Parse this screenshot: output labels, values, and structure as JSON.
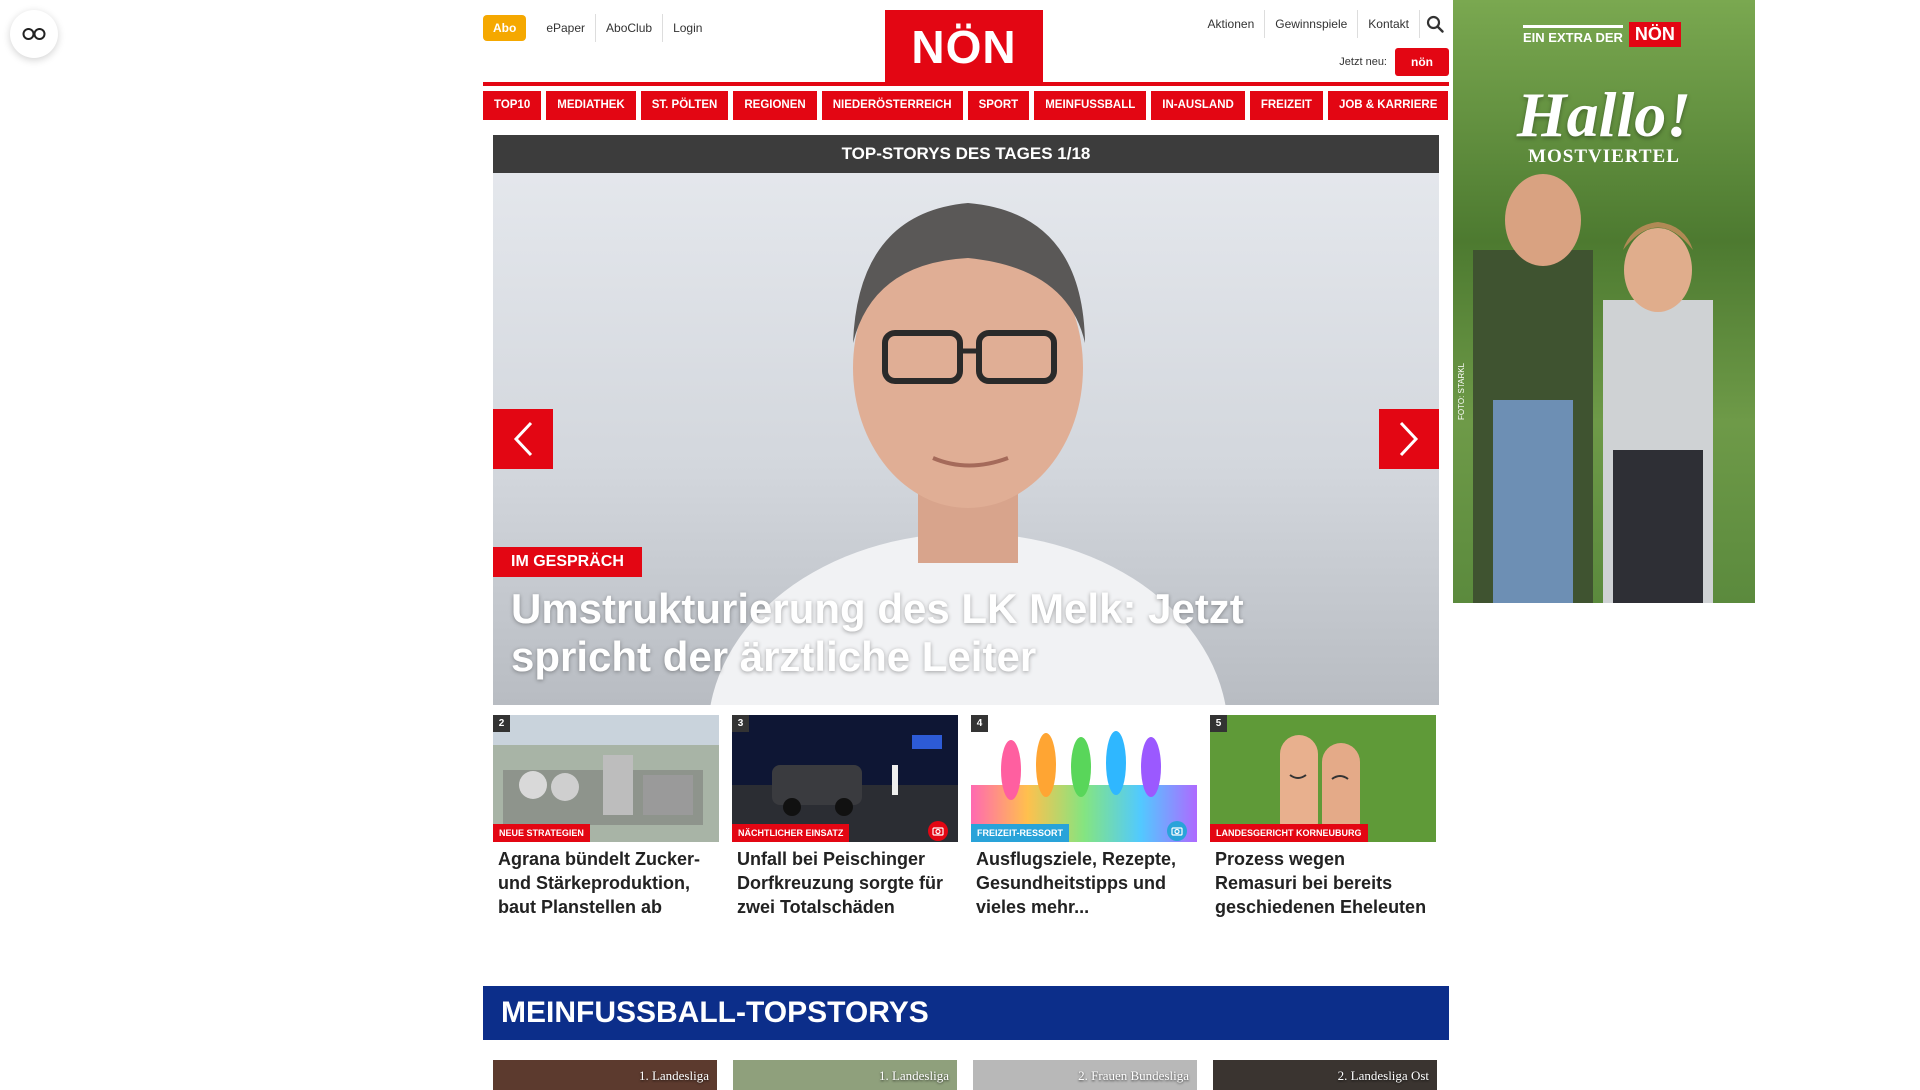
{
  "header": {
    "abo_label": "Abo",
    "top_links_left": [
      "ePaper",
      "AboClub",
      "Login"
    ],
    "logo_text": "NÖN",
    "top_links_right": [
      "Aktionen",
      "Gewinnspiele",
      "Kontakt"
    ],
    "jetzt_label": "Jetzt neu:",
    "mini_logo_text": "nön",
    "search_icon": "search-icon"
  },
  "nav": {
    "items": [
      "TOP10",
      "MEDIATHEK",
      "ST. PÖLTEN",
      "REGIONEN",
      "NIEDERÖSTERREICH",
      "SPORT",
      "MEINFUSSBALL",
      "IN-AUSLAND",
      "FREIZEIT",
      "JOB & KARRIERE"
    ]
  },
  "hero": {
    "bar_title": "TOP-STORYS DES TAGES 1/18",
    "kicker": "IM GESPRÄCH",
    "title": "Umstrukturierung des LK Melk: Jetzt spricht der ärztliche Leiter"
  },
  "teasers": [
    {
      "num": "2",
      "kicker": "NEUE STRATEGIEN",
      "title": "Agrana bündelt Zucker- und Stärkeproduktion, baut Planstellen ab"
    },
    {
      "num": "3",
      "kicker": "NÄCHTLICHER EINSATZ",
      "title": "Unfall bei Peischinger Dorfkreuzung sorgte für zwei Totalschäden"
    },
    {
      "num": "4",
      "kicker": "FREIZEIT-RESSORT",
      "title": "Ausflugsziele, Rezepte, Gesundheitstipps und vieles mehr..."
    },
    {
      "num": "5",
      "kicker": "LANDESGERICHT KORNEUBURG",
      "title": "Prozess wegen Remasuri bei bereits geschiedenen Eheleuten"
    }
  ],
  "fussball": {
    "title": "MEINFUSSBALL-TOPSTORYS",
    "cards": [
      "1. Landesliga",
      "1. Landesliga",
      "2. Frauen Bundesliga",
      "2. Landesliga Ost"
    ]
  },
  "ad": {
    "extra_text": "EIN EXTRA DER",
    "logo_text": "NÖN",
    "hallo": "Hallo!",
    "sub": "MOSTVIERTEL",
    "credit": "FOTO: STARKL"
  },
  "colors": {
    "brand_red": "#e30613",
    "abo_orange": "#f5a800",
    "fussball_blue": "#0c2e8a",
    "freizeit_blue": "#29a3d9"
  }
}
